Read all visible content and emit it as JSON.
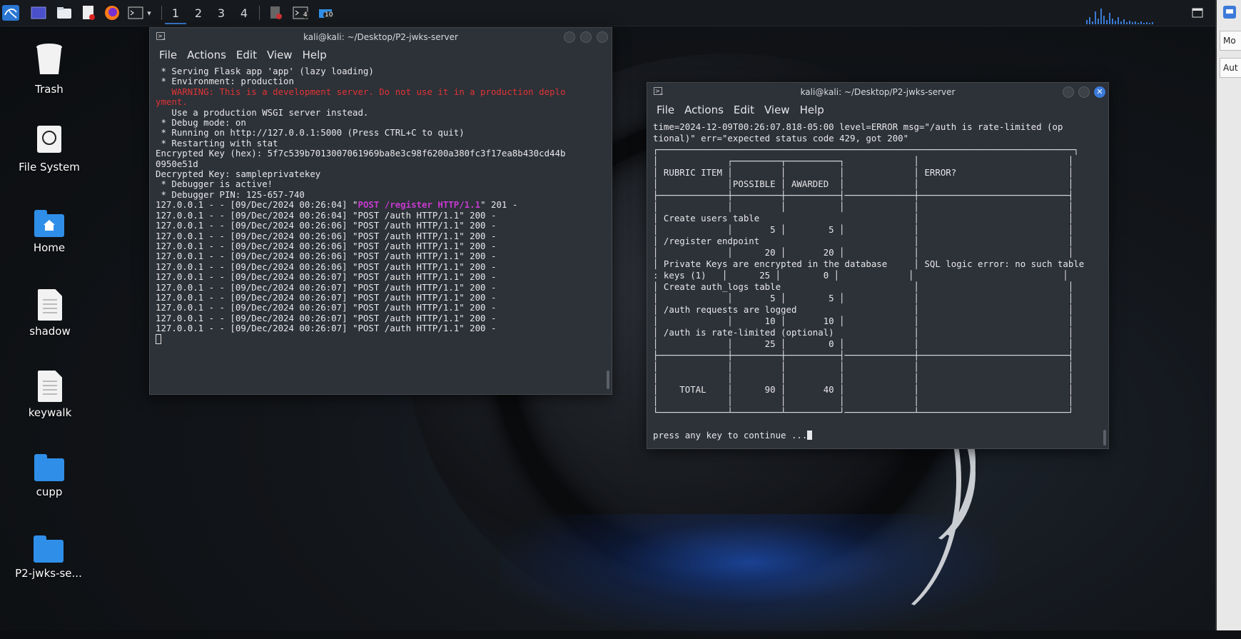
{
  "taskbar": {
    "workspaces": [
      "1",
      "2",
      "3",
      "4"
    ],
    "active_workspace": "1",
    "terminal_badge": "4",
    "files_badge": "10"
  },
  "right_strip": {
    "item1": "Mo",
    "item2": "Aut"
  },
  "desktop": {
    "icons": [
      {
        "label": "Trash",
        "icon": "trash-icon"
      },
      {
        "label": "File System",
        "icon": "drive-icon"
      },
      {
        "label": "Home",
        "icon": "home-folder-icon"
      },
      {
        "label": "shadow",
        "icon": "text-file-icon"
      },
      {
        "label": "keywalk",
        "icon": "text-file-icon"
      },
      {
        "label": "cupp",
        "icon": "folder-icon"
      },
      {
        "label": "P2-jwks-se...",
        "icon": "folder-icon"
      }
    ]
  },
  "terminal1": {
    "title": "kali@kali: ~/Desktop/P2-jwks-server",
    "menu": [
      "File",
      "Actions",
      "Edit",
      "View",
      "Help"
    ],
    "lines": [
      " * Serving Flask app 'app' (lazy loading)",
      " * Environment: production",
      "   WARNING: This is a development server. Do not use it in a production deplo",
      "yment.",
      "   Use a production WSGI server instead.",
      " * Debug mode: on",
      " * Running on http://127.0.0.1:5000 (Press CTRL+C to quit)",
      " * Restarting with stat",
      "Encrypted Key (hex): 5f7c539b7013007061969ba8e3c98f6200a380fc3f17ea8b430cd44b",
      "0950e51d",
      "Decrypted Key: sampleprivatekey",
      " * Debugger is active!",
      " * Debugger PIN: 125-657-740"
    ],
    "register_prefix": "127.0.0.1 - - [09/Dec/2024 00:26:04] \"",
    "register_request": "POST /register HTTP/1.1",
    "register_suffix": "\" 201 -",
    "log_lines": [
      "127.0.0.1 - - [09/Dec/2024 00:26:04] \"POST /auth HTTP/1.1\" 200 -",
      "127.0.0.1 - - [09/Dec/2024 00:26:06] \"POST /auth HTTP/1.1\" 200 -",
      "127.0.0.1 - - [09/Dec/2024 00:26:06] \"POST /auth HTTP/1.1\" 200 -",
      "127.0.0.1 - - [09/Dec/2024 00:26:06] \"POST /auth HTTP/1.1\" 200 -",
      "127.0.0.1 - - [09/Dec/2024 00:26:06] \"POST /auth HTTP/1.1\" 200 -",
      "127.0.0.1 - - [09/Dec/2024 00:26:06] \"POST /auth HTTP/1.1\" 200 -",
      "127.0.0.1 - - [09/Dec/2024 00:26:07] \"POST /auth HTTP/1.1\" 200 -",
      "127.0.0.1 - - [09/Dec/2024 00:26:07] \"POST /auth HTTP/1.1\" 200 -",
      "127.0.0.1 - - [09/Dec/2024 00:26:07] \"POST /auth HTTP/1.1\" 200 -",
      "127.0.0.1 - - [09/Dec/2024 00:26:07] \"POST /auth HTTP/1.1\" 200 -",
      "127.0.0.1 - - [09/Dec/2024 00:26:07] \"POST /auth HTTP/1.1\" 200 -",
      "127.0.0.1 - - [09/Dec/2024 00:26:07] \"POST /auth HTTP/1.1\" 200 -"
    ]
  },
  "terminal2": {
    "title": "kali@kali: ~/Desktop/P2-jwks-server",
    "menu": [
      "File",
      "Actions",
      "Edit",
      "View",
      "Help"
    ],
    "lines": [
      "time=2024-12-09T00:26:07.818-05:00 level=ERROR msg=\"/auth is rate-limited (op",
      "tional)\" err=\"expected status code 429, got 200\"",
      "┌──────────────────────────────────────────────────────────────────────────────┐",
      "│             ┌─────────┬──────────┐             │                            │",
      "│ RUBRIC ITEM │         │          │             │ ERROR?                     │",
      "│             │POSSIBLE │ AWARDED  │             │                            │",
      "├─────────────┼─────────┼──────────┤─────────────┼────────────────────────────┤",
      "│             │         │          │             │                            │",
      "│ Create users table                             │                            │",
      "│             │       5 │        5 │             │                            │",
      "│ /register endpoint                             │                            │",
      "│             │      20 │       20 │             │                            │",
      "│ Private Keys are encrypted in the database     │ SQL logic error: no such table",
      ": keys (1)   │      25 │        0 │             │                            │",
      "│ Create auth_logs table                         │                            │",
      "│             │       5 │        5 │             │                            │",
      "│ /auth requests are logged                      │                            │",
      "│             │      10 │       10 │             │                            │",
      "│ /auth is rate-limited (optional)               │                            │",
      "│             │      25 │        0 │             │                            │",
      "├─────────────┼─────────┼──────────┤─────────────┼────────────────────────────┤",
      "│             │         │          │             │                            │",
      "│             │         │          │             │                            │",
      "│    TOTAL    │      90 │       40 │             │                            │",
      "│             │         │          │             │                            │",
      "└─────────────┴─────────┴──────────┘─────────────┴────────────────────────────┘",
      "",
      "press any key to continue ..."
    ]
  }
}
